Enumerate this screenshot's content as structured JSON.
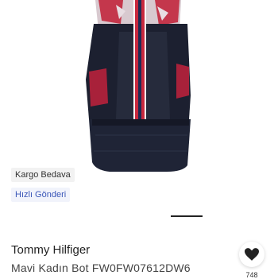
{
  "product": {
    "badges": {
      "shipping": "Kargo Bedava",
      "fast_delivery": "Hızlı Gönderi"
    },
    "brand": "Tommy Hilfiger",
    "title": "Mavi Kadın Bot FW0FW07612DW6",
    "favorite_count": "748",
    "image": {
      "gallery_active_index": 1
    }
  },
  "colors": {
    "fast_delivery_text": "#3b57b8",
    "heart": "#222222",
    "navy": "#1c2030",
    "red": "#c8283e"
  },
  "icons": {
    "favorite": "heart-icon"
  }
}
